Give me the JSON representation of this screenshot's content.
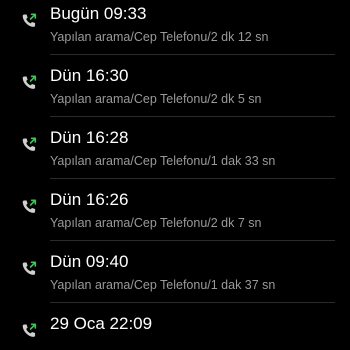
{
  "calls": [
    {
      "time": "Bugün 09:33",
      "detail": "Yapılan arama/Cep Telefonu/2 dk 12 sn",
      "icon": "outgoing-call-icon"
    },
    {
      "time": "Dün 16:30",
      "detail": "Yapılan arama/Cep Telefonu/2 dk 5 sn",
      "icon": "outgoing-call-icon"
    },
    {
      "time": "Dün 16:28",
      "detail": "Yapılan arama/Cep Telefonu/1 dak 33 sn",
      "icon": "outgoing-call-icon"
    },
    {
      "time": "Dün 16:26",
      "detail": "Yapılan arama/Cep Telefonu/2 dk 7 sn",
      "icon": "outgoing-call-icon"
    },
    {
      "time": "Dün 09:40",
      "detail": "Yapılan arama/Cep Telefonu/1 dak 37 sn",
      "icon": "outgoing-call-icon"
    },
    {
      "time": "29 Oca 22:09",
      "detail": "",
      "icon": "outgoing-call-icon"
    }
  ],
  "colors": {
    "background": "#000000",
    "primary_text": "#ffffff",
    "secondary_text": "#9a9a9a",
    "phone_icon": "#cfcfcf",
    "outgoing_arrow": "#3fc35a"
  }
}
